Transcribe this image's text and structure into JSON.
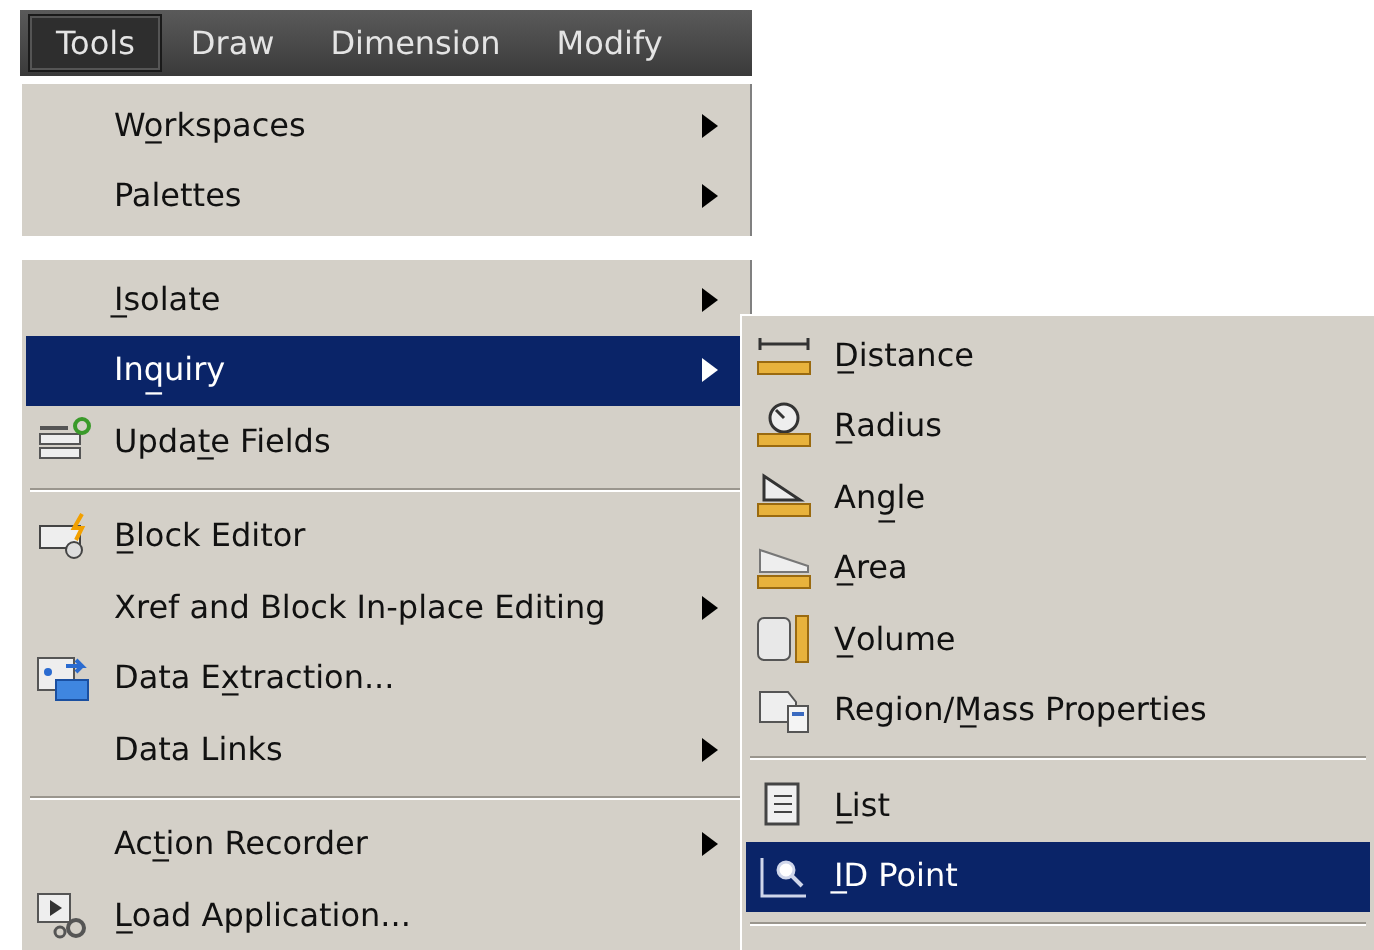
{
  "menu_bar": [
    {
      "label": "Tools",
      "selected": true
    },
    {
      "label": "Draw",
      "selected": false
    },
    {
      "label": "Dimension",
      "selected": false
    },
    {
      "label": "Modify",
      "selected": false
    }
  ],
  "menu_sections": [
    [
      {
        "kind": "item",
        "label": "Wo̲rkspaces",
        "has_submenu": true,
        "selected": false
      },
      {
        "kind": "item",
        "label": "Palettes",
        "has_submenu": true,
        "selected": false
      }
    ],
    [
      {
        "kind": "item",
        "label": "I̲solate",
        "has_submenu": true,
        "selected": false
      },
      {
        "kind": "item",
        "label": "Inq̲uiry",
        "has_submenu": true,
        "selected": true
      },
      {
        "kind": "item",
        "label": "Updat̲e Fields",
        "has_submenu": false,
        "selected": false
      },
      {
        "kind": "separator"
      },
      {
        "kind": "item",
        "label": "B̲lock Editor",
        "has_submenu": false,
        "selected": false
      },
      {
        "kind": "item",
        "label": "Xref and Block In-place Editing",
        "has_submenu": true,
        "selected": false
      },
      {
        "kind": "item",
        "label": "Data Ex̲traction...",
        "has_submenu": false,
        "selected": false
      },
      {
        "kind": "item",
        "label": "Data Links",
        "has_submenu": true,
        "selected": false
      },
      {
        "kind": "separator"
      },
      {
        "kind": "item",
        "label": "Act̲ion Recorder",
        "has_submenu": true,
        "selected": false
      },
      {
        "kind": "item",
        "label": "L̲oad Application...",
        "has_submenu": false,
        "selected": false
      }
    ]
  ],
  "submenu": [
    {
      "kind": "item",
      "label": "D̲istance",
      "selected": false
    },
    {
      "kind": "item",
      "label": "R̲adius",
      "selected": false
    },
    {
      "kind": "item",
      "label": "Ang̲le",
      "selected": false
    },
    {
      "kind": "item",
      "label": "A̲rea",
      "selected": false
    },
    {
      "kind": "item",
      "label": "V̲olume",
      "selected": false
    },
    {
      "kind": "item",
      "label": "Region/M̲ass Properties",
      "selected": false
    },
    {
      "kind": "separator"
    },
    {
      "kind": "item",
      "label": "L̲ist",
      "selected": false
    },
    {
      "kind": "item",
      "label": "I̲D Point",
      "selected": true
    },
    {
      "kind": "separator"
    }
  ]
}
